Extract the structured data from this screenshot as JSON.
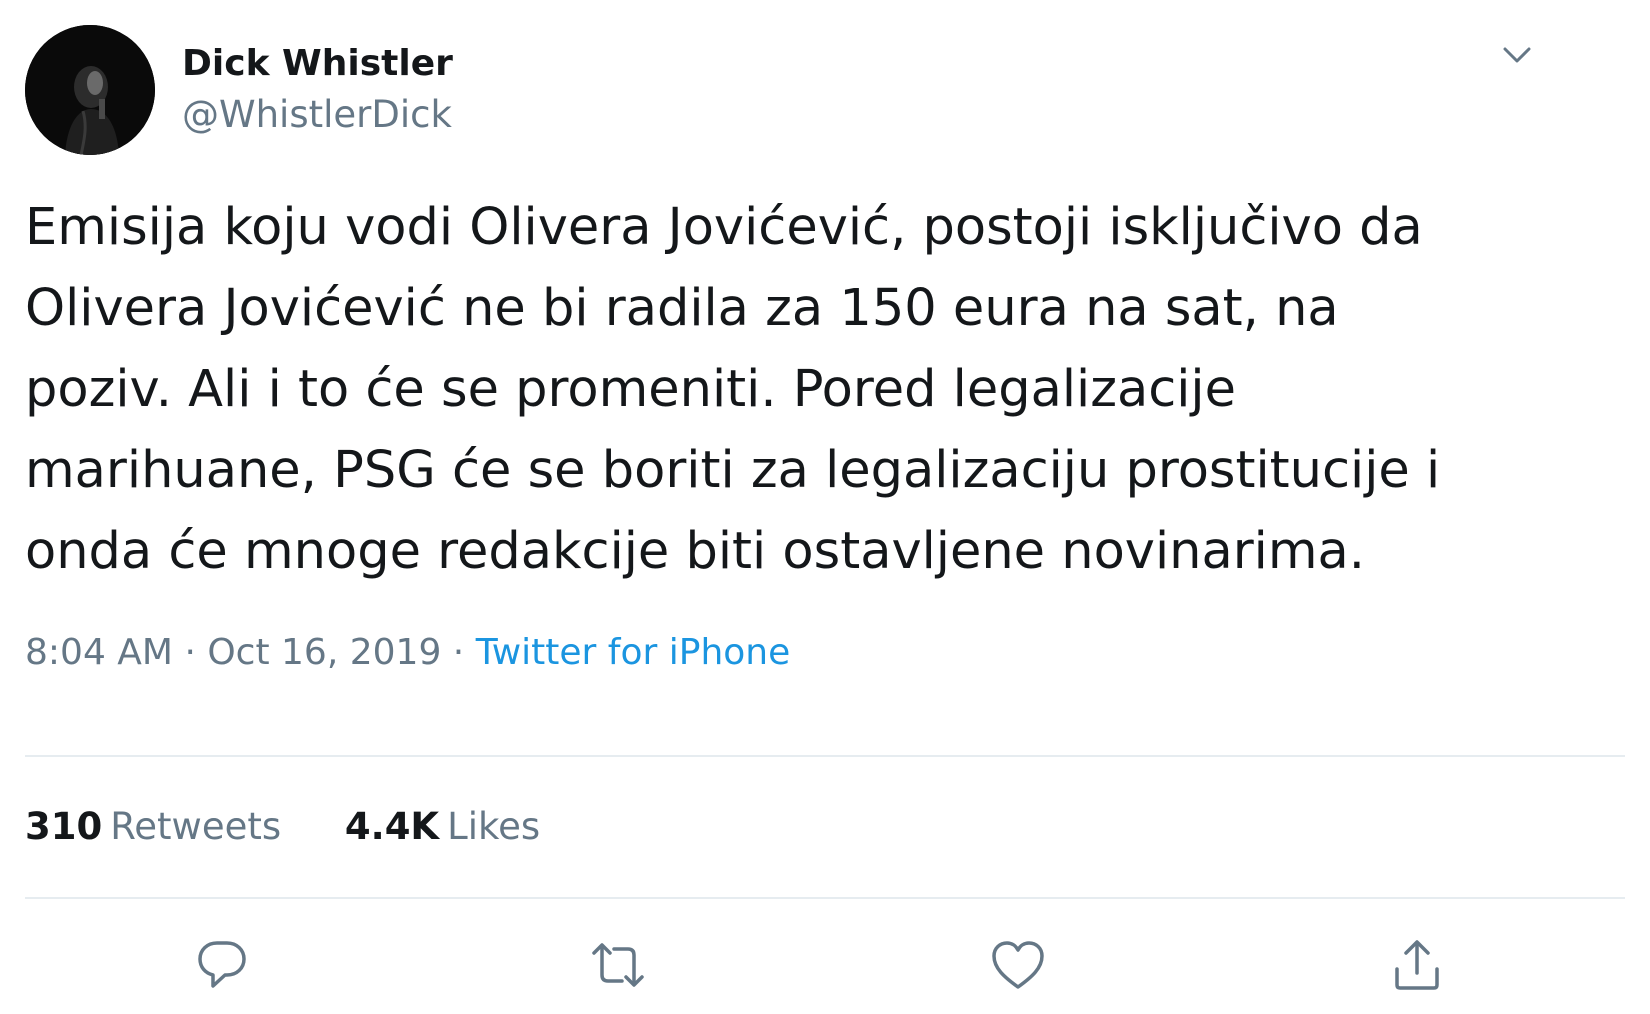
{
  "author": {
    "display_name": "Dick Whistler",
    "handle": "@WhistlerDick",
    "avatar_icon": "profile-photo-dark"
  },
  "tweet": {
    "text_lines": [
      "Emisija koju vodi Olivera Jovićević, postoji isključivo da",
      "Olivera Jovićević ne bi radila za 150 eura na sat, na",
      "poziv. Ali i to će se promeniti. Pored legalizacije",
      "marihuane, PSG će se boriti za legalizaciju prostitucije i",
      "onda će mnoge redakcije biti ostavljene novinarima."
    ],
    "time": "8:04 AM",
    "separator": "·",
    "date": "Oct 16, 2019",
    "source": "Twitter for iPhone"
  },
  "stats": {
    "retweets_count": "310",
    "retweets_label": "Retweets",
    "likes_count": "4.4K",
    "likes_label": "Likes"
  },
  "actions": [
    {
      "name": "reply",
      "icon": "reply-icon"
    },
    {
      "name": "retweet",
      "icon": "retweet-icon"
    },
    {
      "name": "like",
      "icon": "heart-icon"
    },
    {
      "name": "share",
      "icon": "share-icon"
    }
  ],
  "colors": {
    "text_primary": "#14171a",
    "text_secondary": "#657786",
    "link": "#1b95e0",
    "divider": "#e6ecf0",
    "icon": "#657786"
  }
}
